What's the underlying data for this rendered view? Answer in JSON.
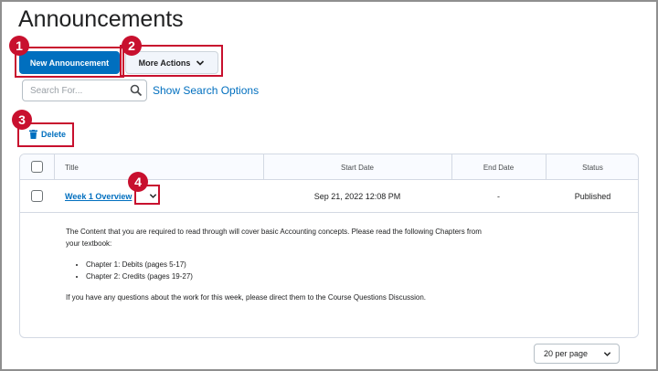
{
  "page": {
    "title": "Announcements"
  },
  "toolbar": {
    "new_label": "New Announcement",
    "more_label": "More Actions"
  },
  "search": {
    "placeholder": "Search For...",
    "options_link": "Show Search Options"
  },
  "actions": {
    "delete_label": "Delete"
  },
  "callouts": [
    "1",
    "2",
    "3",
    "4"
  ],
  "table": {
    "headers": [
      "Title",
      "Start Date",
      "End Date",
      "Status"
    ],
    "rows": [
      {
        "title": "Week 1 Overview",
        "start_date": "Sep 21, 2022 12:08 PM",
        "end_date": "-",
        "status": "Published"
      }
    ]
  },
  "content": {
    "intro": "The Content that you are required to read through will cover basic Accounting concepts. Please read the following Chapters from your textbook:",
    "bullets": [
      "Chapter 1: Debits (pages 5-17)",
      "Chapter 2: Credits (pages 19-27)"
    ],
    "closing": "If you have any questions about the work for this week, please direct them to the Course Questions Discussion."
  },
  "pagination": {
    "per_page": "20 per page"
  },
  "colors": {
    "primary": "#006fbf",
    "callout": "#c8102e"
  }
}
